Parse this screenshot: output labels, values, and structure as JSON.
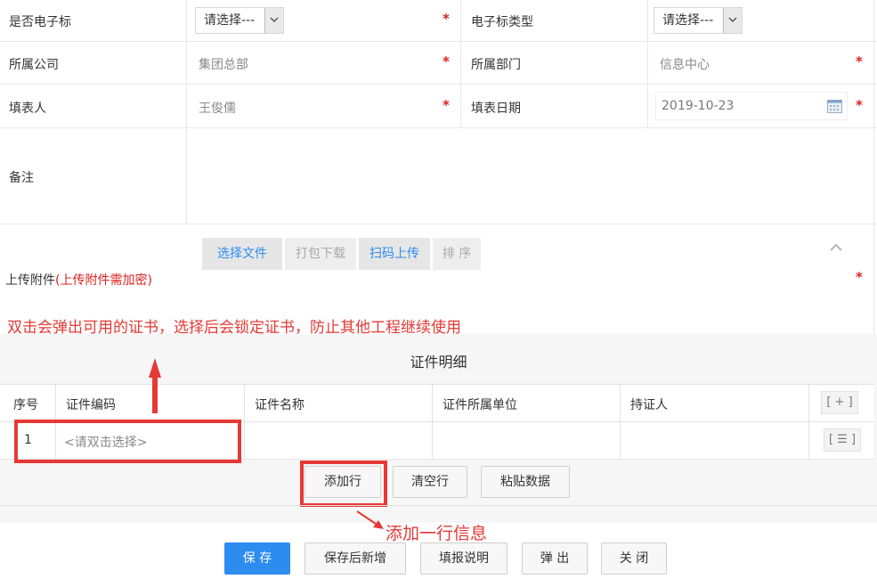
{
  "form": {
    "is_electronic_label": "是否电子标",
    "is_electronic_value": "请选择---",
    "electronic_type_label": "电子标类型",
    "electronic_type_value": "请选择---",
    "company_label": "所属公司",
    "company_value": "集团总部",
    "department_label": "所属部门",
    "department_value": "信息中心",
    "filler_label": "填表人",
    "filler_value": "王俊儒",
    "date_label": "填表日期",
    "date_value": "2019-10-23",
    "remark_label": "备注",
    "upload_label": "上传附件",
    "upload_note": "(上传附件需加密)",
    "required_mark": "*"
  },
  "upload_toolbar": {
    "select_file": "选择文件",
    "pack_download": "打包下载",
    "scan_upload": "扫码上传",
    "sort": "排 序"
  },
  "annotations": {
    "top_note": "双击会弹出可用的证书，选择后会锁定证书，防止其他工程继续使用",
    "add_row_note": "添加一行信息"
  },
  "detail": {
    "title": "证件明细",
    "columns": [
      "序号",
      "证件编码",
      "证件名称",
      "证件所属单位",
      "持证人"
    ],
    "add_col_button": "[ + ]",
    "rows": [
      {
        "index": "1",
        "code_placeholder": "<请双击选择>",
        "menu_button": "[ ☰ ]"
      }
    ],
    "actions": {
      "add_row": "添加行",
      "clear_rows": "清空行",
      "paste_data": "粘贴数据"
    }
  },
  "footer": {
    "save": "保 存",
    "save_and_new": "保存后新增",
    "instructions": "填报说明",
    "popup": "弹 出",
    "close": "关 闭"
  },
  "colors": {
    "accent": "#2d8cf0",
    "required": "#e02020",
    "annotation": "#e53935"
  }
}
